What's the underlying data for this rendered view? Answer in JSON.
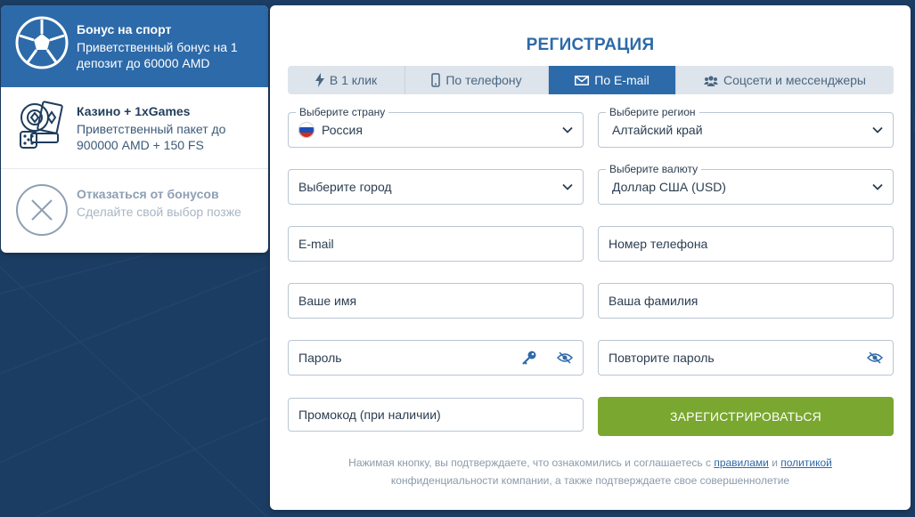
{
  "colors": {
    "background": "#1c3d63",
    "accent": "#2d6aa9",
    "submit": "#79a72f"
  },
  "bonuses": [
    {
      "title": "Бонус на спорт",
      "desc_line1": "Приветственный бонус на 1",
      "desc_line2": "депозит до 60000 AMD",
      "icon": "soccer-ball-icon"
    },
    {
      "title": "Казино + 1xGames",
      "desc_line1": "Приветственный пакет до",
      "desc_line2": "900000 AMD + 150 FS",
      "icon": "casino-chips-cards-icon"
    },
    {
      "title": "Отказаться от бонусов",
      "desc_line1": "Сделайте свой выбор позже",
      "icon": "close-circle-icon"
    }
  ],
  "registration": {
    "title": "РЕГИСТРАЦИЯ",
    "tabs": [
      {
        "label": "В 1 клик",
        "icon": "lightning-icon"
      },
      {
        "label": "По телефону",
        "icon": "phone-icon"
      },
      {
        "label": "По E-mail",
        "icon": "envelope-icon",
        "active": true
      },
      {
        "label": "Соцсети и мессенджеры",
        "icon": "people-icon"
      }
    ],
    "country": {
      "label": "Выберите страну",
      "value": "Россия"
    },
    "region": {
      "label": "Выберите регион",
      "value": "Алтайский край"
    },
    "city": {
      "placeholder": "Выберите город"
    },
    "currency": {
      "label": "Выберите валюту",
      "value": "Доллар США (USD)"
    },
    "email": {
      "placeholder": "E-mail"
    },
    "phone": {
      "placeholder": "Номер телефона"
    },
    "first_name": {
      "placeholder": "Ваше имя"
    },
    "last_name": {
      "placeholder": "Ваша фамилия"
    },
    "password": {
      "placeholder": "Пароль"
    },
    "password_repeat": {
      "placeholder": "Повторите пароль"
    },
    "promo": {
      "placeholder": "Промокод (при наличии)"
    },
    "submit_label": "ЗАРЕГИСТРИРОВАТЬСЯ",
    "footnote": {
      "part1": "Нажимая кнопку, вы подтверждаете, что ознакомились и соглашаетесь с ",
      "rules_link": "правилами",
      "and": " и ",
      "policy_link": "политикой",
      "part2": "конфиденциальности компании, а также подтверждаете свое совершеннолетие"
    }
  }
}
